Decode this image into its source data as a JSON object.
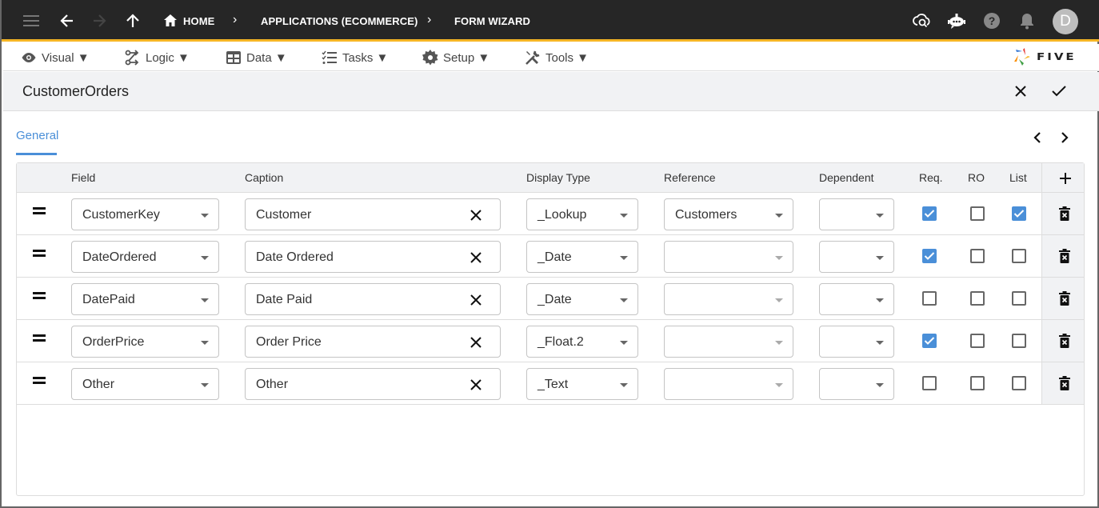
{
  "topbar": {
    "breadcrumbs": [
      "HOME",
      "APPLICATIONS (ECOMMERCE)",
      "FORM WIZARD"
    ],
    "avatar_initial": "D",
    "icons": [
      "menu-icon",
      "back-arrow-icon",
      "forward-arrow-icon",
      "up-arrow-icon",
      "home-icon",
      "cloud-search-icon",
      "chatbot-icon",
      "help-icon",
      "notifications-bell-icon"
    ]
  },
  "menubar": {
    "items": [
      {
        "label": "Visual ▼",
        "icon": "eye-icon"
      },
      {
        "label": "Logic ▼",
        "icon": "logic-flow-icon"
      },
      {
        "label": "Data ▼",
        "icon": "table-icon"
      },
      {
        "label": "Tasks ▼",
        "icon": "checklist-icon"
      },
      {
        "label": "Setup ▼",
        "icon": "gear-icon"
      },
      {
        "label": "Tools ▼",
        "icon": "tools-icon"
      }
    ],
    "logo_text": "FIVE"
  },
  "form": {
    "title": "CustomerOrders",
    "tabs": [
      {
        "label": "General",
        "active": true
      }
    ]
  },
  "grid": {
    "columns": [
      "Field",
      "Caption",
      "Display Type",
      "Reference",
      "Dependent",
      "Req.",
      "RO",
      "List"
    ],
    "rows": [
      {
        "field": "CustomerKey",
        "caption": "Customer",
        "display_type": "_Lookup",
        "reference": "Customers",
        "reference_enabled": true,
        "dependent": "",
        "req": true,
        "ro": false,
        "list": true
      },
      {
        "field": "DateOrdered",
        "caption": "Date Ordered",
        "display_type": "_Date",
        "reference": "",
        "reference_enabled": false,
        "dependent": "",
        "req": true,
        "ro": false,
        "list": false
      },
      {
        "field": "DatePaid",
        "caption": "Date Paid",
        "display_type": "_Date",
        "reference": "",
        "reference_enabled": false,
        "dependent": "",
        "req": false,
        "ro": false,
        "list": false
      },
      {
        "field": "OrderPrice",
        "caption": "Order Price",
        "display_type": "_Float.2",
        "reference": "",
        "reference_enabled": false,
        "dependent": "",
        "req": true,
        "ro": false,
        "list": false
      },
      {
        "field": "Other",
        "caption": "Other",
        "display_type": "_Text",
        "reference": "",
        "reference_enabled": false,
        "dependent": "",
        "req": false,
        "ro": false,
        "list": false
      }
    ]
  },
  "colors": {
    "topbar_bg": "#262626",
    "accent_yellow": "#f5b525",
    "accent_blue": "#4a8fd8",
    "header_bg": "#f1f2f4"
  }
}
